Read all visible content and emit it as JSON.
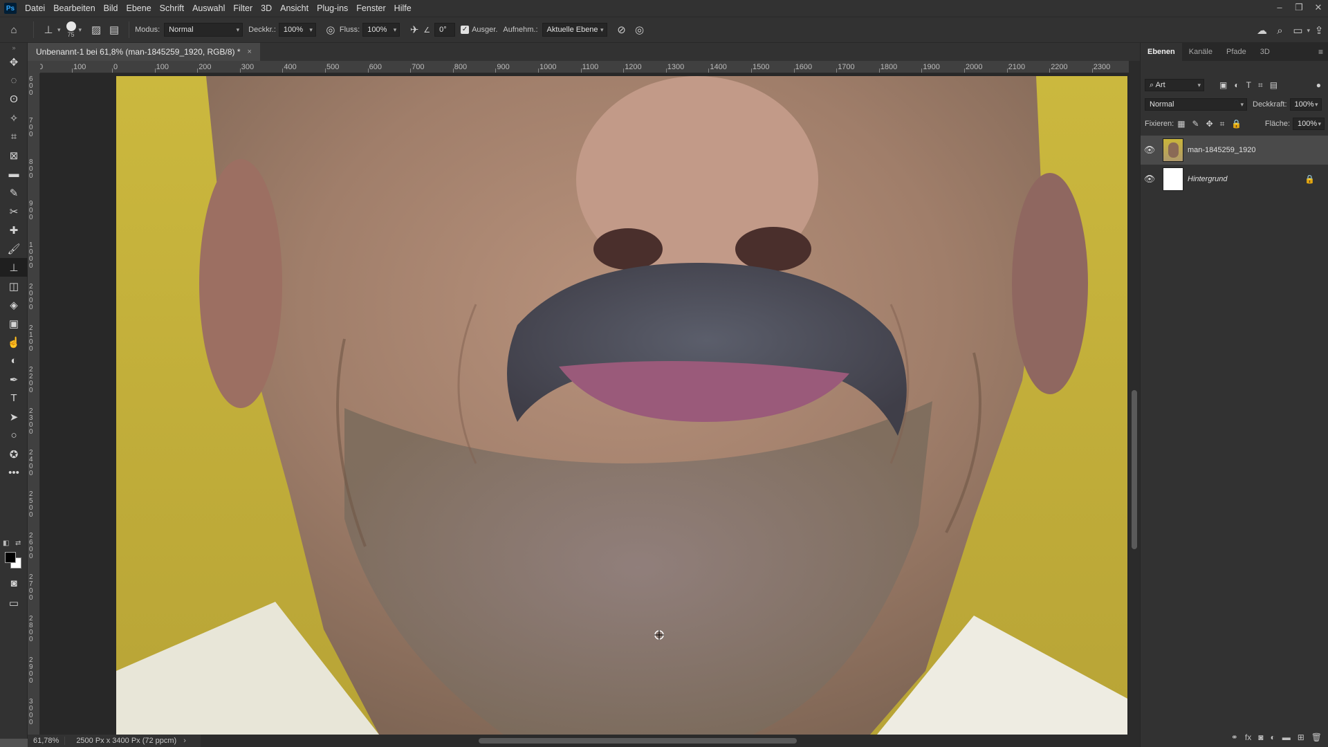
{
  "app": {
    "logo": "Ps"
  },
  "menu": [
    "Datei",
    "Bearbeiten",
    "Bild",
    "Ebene",
    "Schrift",
    "Auswahl",
    "Filter",
    "3D",
    "Ansicht",
    "Plug-ins",
    "Fenster",
    "Hilfe"
  ],
  "options": {
    "brush_size": "75",
    "mode_label": "Modus:",
    "mode_value": "Normal",
    "opacity_label": "Deckkr.:",
    "opacity_value": "100%",
    "flow_label": "Fluss:",
    "flow_value": "100%",
    "angle_value": "0°",
    "aligned_label": "Ausger.",
    "sample_label": "Aufnehm.:",
    "sample_value": "Aktuelle Ebene"
  },
  "document": {
    "tab_title": "Unbenannt-1 bei 61,8% (man-1845259_1920, RGB/8) *",
    "close": "×"
  },
  "ruler_top": [
    "0",
    "100",
    "0",
    "100",
    "200",
    "300",
    "400",
    "500",
    "600",
    "700",
    "800",
    "900",
    "1000",
    "1100",
    "1200",
    "1300",
    "1400",
    "1500",
    "1600",
    "1700",
    "1800",
    "1900",
    "2000",
    "2100",
    "2200",
    "2300"
  ],
  "ruler_left": [
    "600",
    "700",
    "800",
    "900",
    "1000",
    "2000",
    "2100",
    "2200",
    "2300",
    "2400",
    "2500",
    "2600",
    "2700",
    "2800",
    "2900",
    "3000"
  ],
  "status": {
    "zoom": "61,78%",
    "dimensions": "2500 Px x 3400 Px (72 ppcm)"
  },
  "layers_panel": {
    "tabs": [
      "Ebenen",
      "Kanäle",
      "Pfade",
      "3D"
    ],
    "filter_label": "Art",
    "blend_mode": "Normal",
    "opacity_label": "Deckkraft:",
    "opacity_value": "100%",
    "lock_label": "Fixieren:",
    "fill_label": "Fläche:",
    "fill_value": "100%",
    "layers": [
      {
        "name": "man-1845259_1920",
        "selected": true
      },
      {
        "name": "Hintergrund",
        "selected": false
      }
    ]
  },
  "colors": {
    "foreground": "#000000",
    "background": "#ffffff",
    "wall": "#c9b53a"
  }
}
